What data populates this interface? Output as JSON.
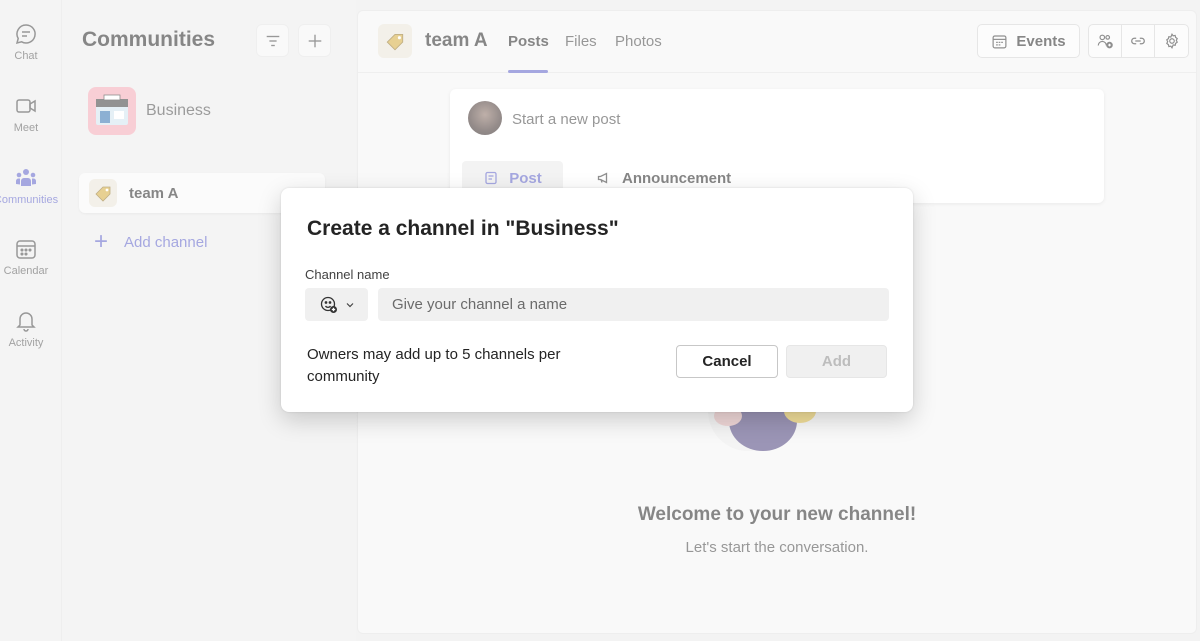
{
  "rail": {
    "items": [
      {
        "label": "Chat",
        "icon": "chat-icon"
      },
      {
        "label": "Meet",
        "icon": "video-icon"
      },
      {
        "label": "Communities",
        "icon": "communities-icon",
        "active": true
      },
      {
        "label": "Calendar",
        "icon": "calendar-icon"
      },
      {
        "label": "Activity",
        "icon": "bell-icon"
      }
    ]
  },
  "panel": {
    "title": "Communities",
    "community_name": "Business",
    "channel_name": "team A",
    "add_channel_label": "Add channel"
  },
  "main": {
    "team_name": "team A",
    "tabs": [
      "Posts",
      "Files",
      "Photos"
    ],
    "events_label": "Events",
    "post_prompt": "Start a new post",
    "post_tab": "Post",
    "announcement_tab": "Announcement",
    "welcome_title": "Welcome to your new channel!",
    "welcome_sub": "Let's start the conversation."
  },
  "dialog": {
    "title": "Create a channel in \"Business\"",
    "field_label": "Channel name",
    "input_value": "",
    "input_placeholder": "Give your channel a name",
    "info_text": "Owners may add up to 5 channels per community",
    "cancel_label": "Cancel",
    "add_label": "Add"
  },
  "colors": {
    "accent": "#5b5fc7",
    "background": "#ebebeb"
  }
}
